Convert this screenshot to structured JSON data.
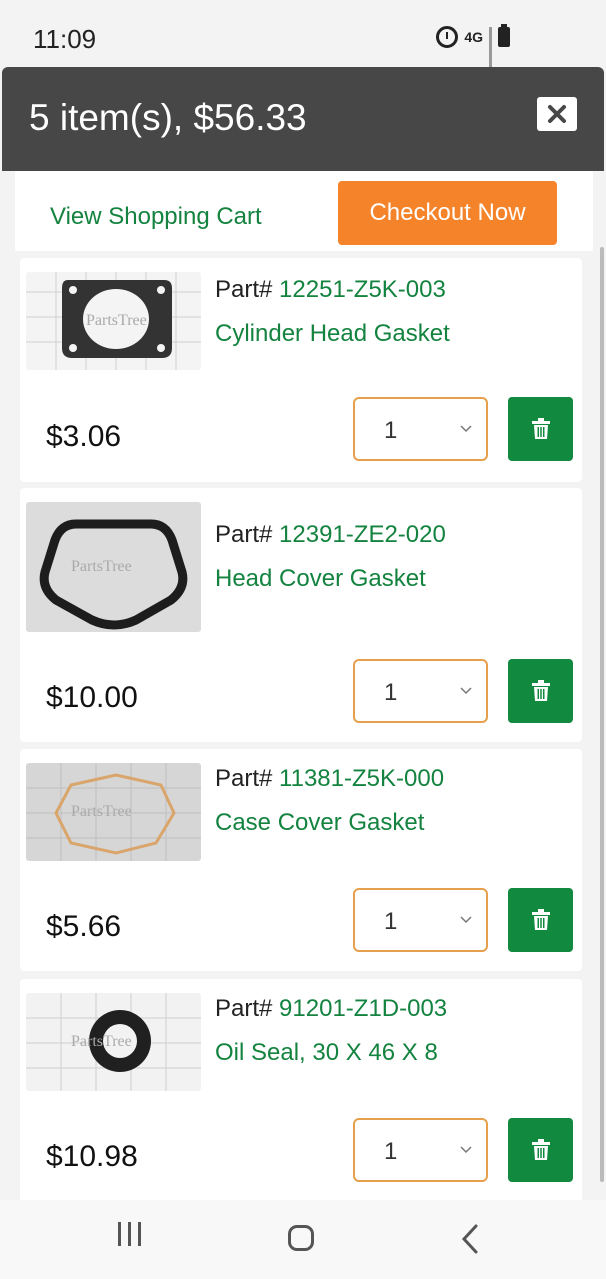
{
  "status_bar": {
    "time": "11:09",
    "network": "4G",
    "icons": [
      "alarm-icon",
      "network-4g-icon",
      "signal-icon",
      "battery-icon"
    ]
  },
  "cart": {
    "title": "5 item(s), $56.33",
    "close_icon": "close-icon",
    "view_cart_label": "View Shopping Cart",
    "checkout_label": "Checkout Now",
    "part_prefix": "Part#",
    "items": [
      {
        "part_number": "12251-Z5K-003",
        "name": "Cylinder Head Gasket",
        "price": "$3.06",
        "quantity": "1",
        "thumbnail_watermark": "PartsTree"
      },
      {
        "part_number": "12391-ZE2-020",
        "name": "Head Cover Gasket",
        "price": "$10.00",
        "quantity": "1",
        "thumbnail_watermark": "PartsTree"
      },
      {
        "part_number": "11381-Z5K-000",
        "name": "Case Cover Gasket",
        "price": "$5.66",
        "quantity": "1",
        "thumbnail_watermark": "PartsTree"
      },
      {
        "part_number": "91201-Z1D-003",
        "name": "Oil Seal, 30 X 46 X 8",
        "price": "$10.98",
        "quantity": "1",
        "thumbnail_watermark": "PartsTree"
      }
    ]
  },
  "colors": {
    "header_bg": "#474747",
    "accent_green": "#11893f",
    "checkout_orange": "#f5832a",
    "qty_border": "#e6a04c"
  },
  "nav_bar": {
    "icons": [
      "recents-icon",
      "home-icon",
      "back-icon"
    ]
  }
}
